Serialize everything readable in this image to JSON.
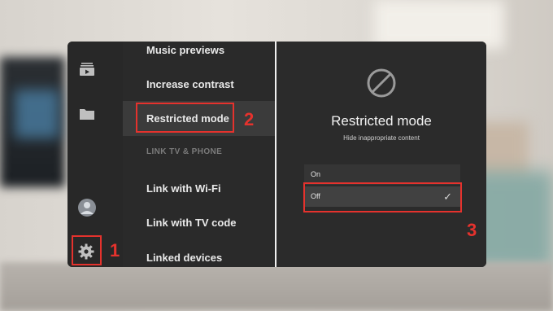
{
  "sidebar": {
    "icons": [
      "subscriptions-icon",
      "library-folder-icon",
      "avatar",
      "gear-icon"
    ]
  },
  "menu": {
    "items": [
      {
        "label": "Music previews"
      },
      {
        "label": "Increase contrast"
      },
      {
        "label": "Restricted mode"
      },
      {
        "label": "Link with Wi-Fi"
      },
      {
        "label": "Link with TV code"
      },
      {
        "label": "Linked devices"
      }
    ],
    "section_label": "LINK TV & PHONE"
  },
  "detail": {
    "title": "Restricted mode",
    "subtitle": "Hide inappropriate content",
    "options": [
      {
        "label": "On",
        "selected": false
      },
      {
        "label": "Off",
        "selected": true
      }
    ]
  },
  "annotations": {
    "step1": "1",
    "step2": "2",
    "step3": "3",
    "color": "#e5322d"
  }
}
